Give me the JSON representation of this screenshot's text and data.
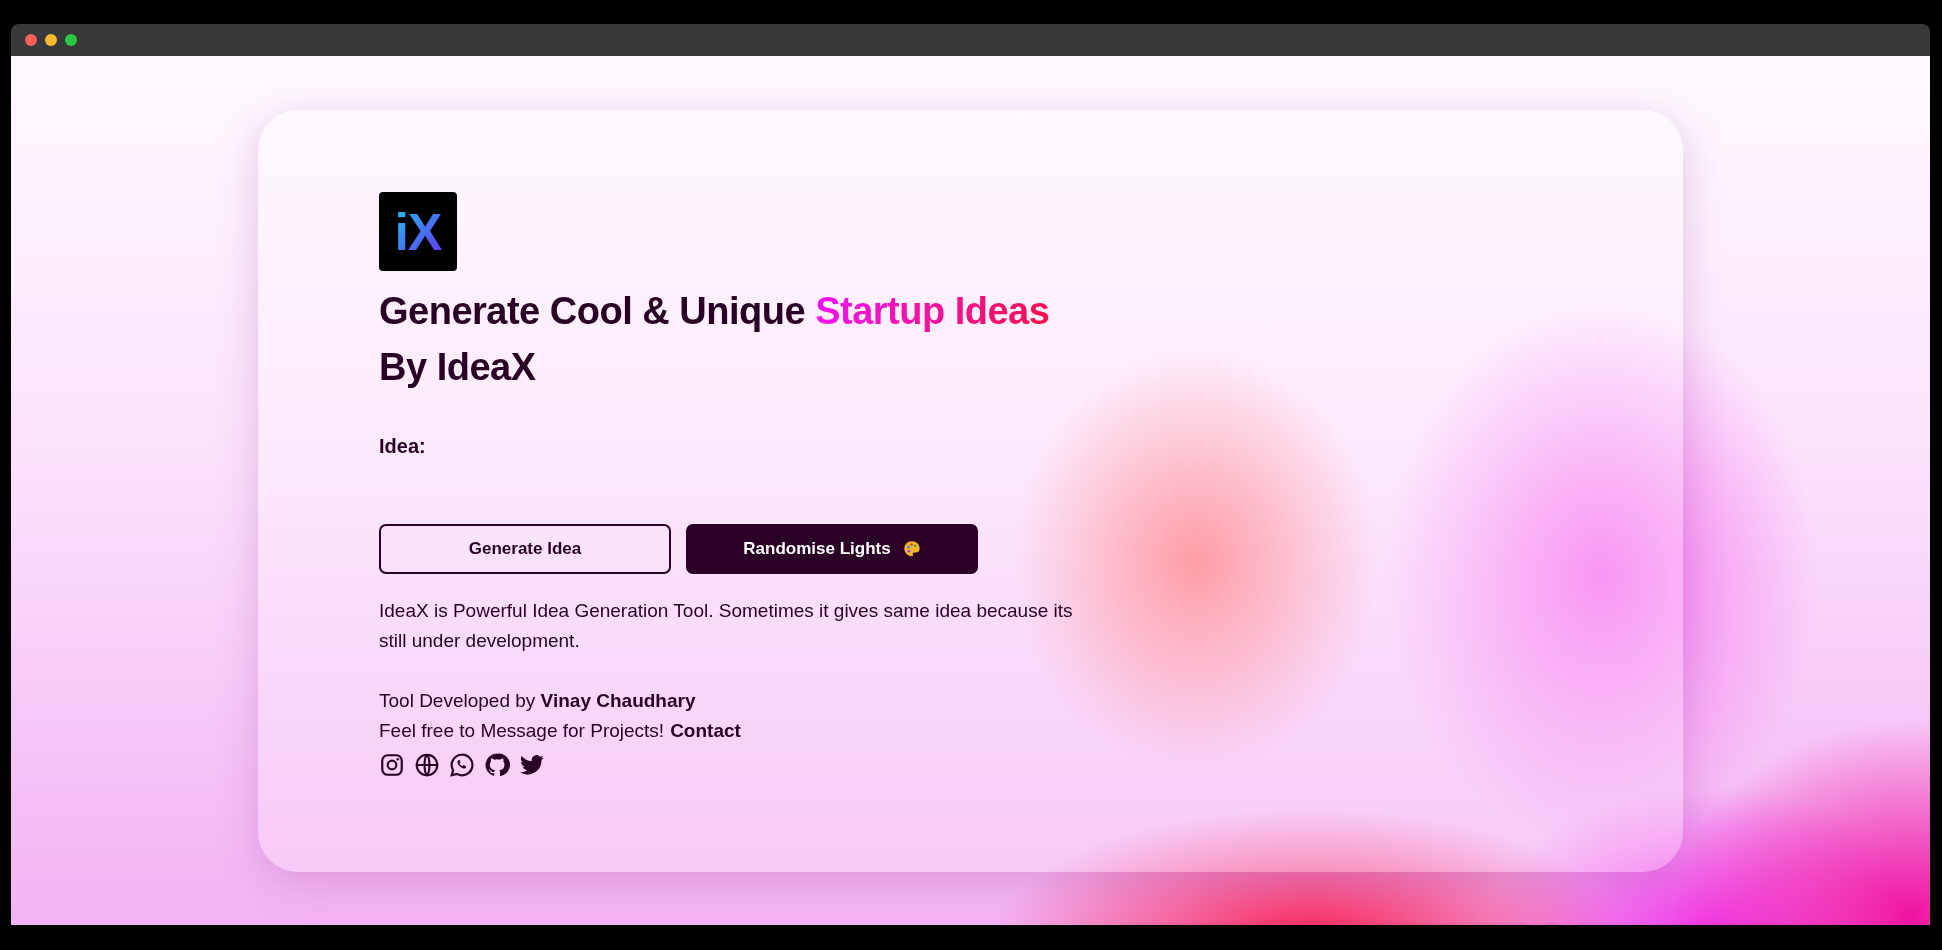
{
  "logo": {
    "text": "iX"
  },
  "title": [
    {
      "text": "Generate Cool & Unique ",
      "highlight": false
    },
    {
      "text": "Startup Ideas",
      "highlight": true
    },
    {
      "text": " By IdeaX",
      "highlight": false
    }
  ],
  "idea_label": "Idea:",
  "buttons": [
    {
      "label": "Generate Idea",
      "kind": "outline"
    },
    {
      "label": "Randomise Lights",
      "kind": "filled"
    }
  ],
  "description": "IdeaX is Powerful Idea Generation Tool. Sometimes it gives same idea because its still under development.",
  "credit": "Tool Developed by **Vinay Chaudhary**",
  "message": {
    "text": "Feel free to Message for Projects!",
    "link": "Contact"
  },
  "social_links": [
    {
      "kind": "instagram"
    },
    {
      "kind": "web"
    },
    {
      "kind": "whatsapp"
    },
    {
      "kind": "github"
    },
    {
      "kind": "twitter"
    }
  ]
}
